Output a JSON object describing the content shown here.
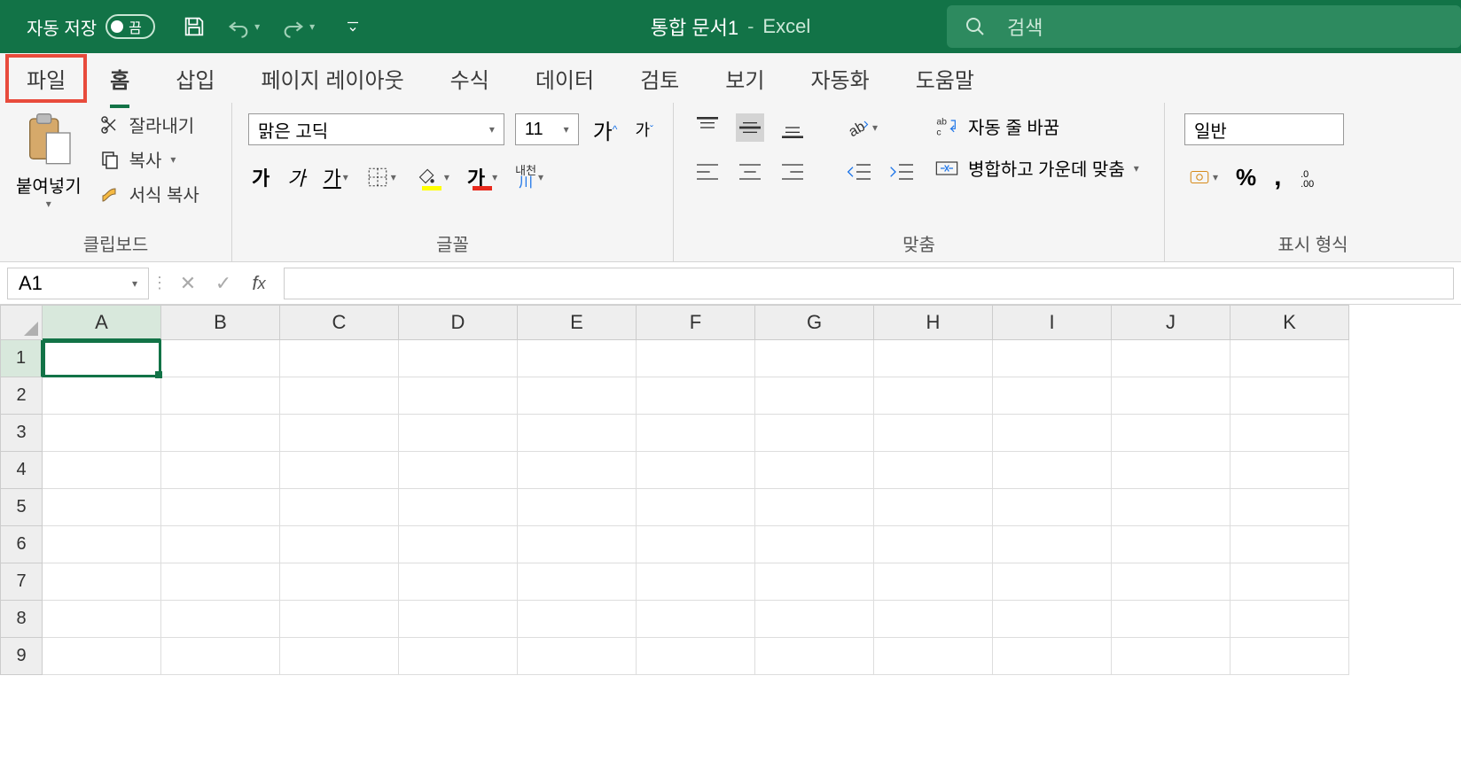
{
  "titlebar": {
    "autosave_label": "자동 저장",
    "autosave_state": "끔",
    "doc_title": "통합 문서1",
    "app_name": "Excel",
    "search_placeholder": "검색"
  },
  "tabs": {
    "file": "파일",
    "home": "홈",
    "insert": "삽입",
    "page_layout": "페이지 레이아웃",
    "formulas": "수식",
    "data": "데이터",
    "review": "검토",
    "view": "보기",
    "automate": "자동화",
    "help": "도움말"
  },
  "ribbon": {
    "clipboard": {
      "paste": "붙여넣기",
      "cut": "잘라내기",
      "copy": "복사",
      "format_painter": "서식 복사",
      "label": "클립보드"
    },
    "font": {
      "font_name": "맑은 고딕",
      "font_size": "11",
      "bold": "가",
      "italic": "가",
      "underline": "가",
      "ruby": "내천",
      "ruby2": "川",
      "label": "글꼴"
    },
    "align": {
      "wrap": "자동 줄 바꿈",
      "merge": "병합하고 가운데 맞춤",
      "label": "맞춤"
    },
    "number": {
      "format": "일반",
      "label": "표시 형식"
    }
  },
  "formulabar": {
    "namebox": "A1"
  },
  "grid": {
    "cols": [
      "A",
      "B",
      "C",
      "D",
      "E",
      "F",
      "G",
      "H",
      "I",
      "J",
      "K"
    ],
    "rows": [
      "1",
      "2",
      "3",
      "4",
      "5",
      "6",
      "7",
      "8",
      "9"
    ]
  }
}
